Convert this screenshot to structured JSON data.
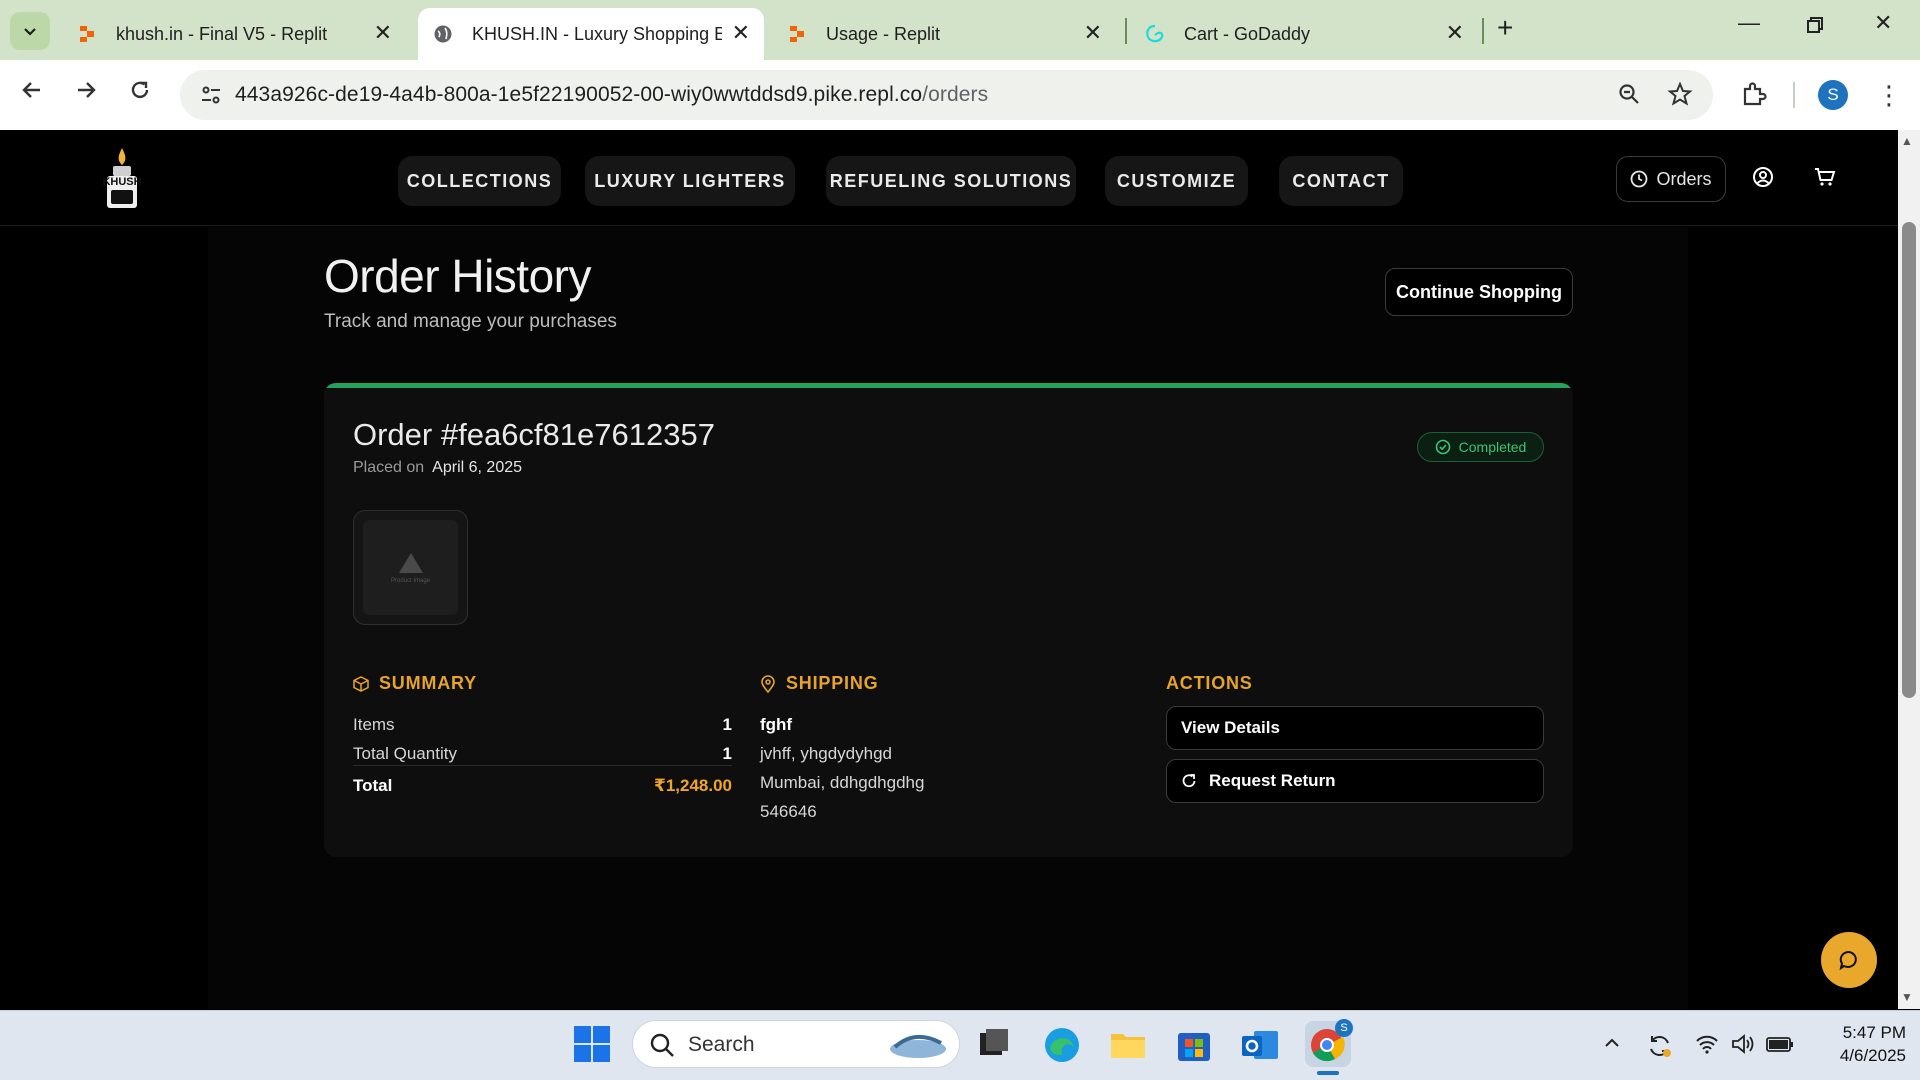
{
  "browser": {
    "tabs": [
      {
        "title": "khush.in - Final V5 - Replit",
        "icon": "replit-icon",
        "active": false
      },
      {
        "title": "KHUSH.IN - Luxury Shopping Ex",
        "icon": "globe-icon",
        "active": true
      },
      {
        "title": "Usage - Replit",
        "icon": "replit-icon",
        "active": false
      },
      {
        "title": "Cart - GoDaddy",
        "icon": "godaddy-icon",
        "active": false
      }
    ],
    "url_host": "443a926c-de19-4a4b-800a-1e5f22190052-00-wiy0wwtddsd9.pike.repl.co",
    "url_path": "/orders",
    "profile_initial": "S"
  },
  "site": {
    "logo_text": "KHUSH",
    "nav": [
      "COLLECTIONS",
      "LUXURY LIGHTERS",
      "REFUELING SOLUTIONS",
      "CUSTOMIZE",
      "CONTACT"
    ],
    "orders_label": "Orders"
  },
  "page": {
    "title": "Order History",
    "subtitle": "Track and manage your purchases",
    "continue_label": "Continue Shopping"
  },
  "order": {
    "id_label": "Order #fea6cf81e7612357",
    "placed_label": "Placed on",
    "placed_date": "April 6, 2025",
    "status": "Completed",
    "image_caption": "Product Image",
    "summary": {
      "heading": "SUMMARY",
      "items_label": "Items",
      "items_value": "1",
      "qty_label": "Total Quantity",
      "qty_value": "1",
      "total_label": "Total",
      "total_value": "₹1,248.00"
    },
    "shipping": {
      "heading": "SHIPPING",
      "name": "fghf",
      "line1": "jvhff, yhgdydyhgd",
      "line2": "Mumbai, ddhgdhgdhg",
      "line3": "546646"
    },
    "actions": {
      "heading": "ACTIONS",
      "view_details": "View Details",
      "request_return": "Request Return"
    }
  },
  "taskbar": {
    "search_label": "Search",
    "time": "5:47 PM",
    "date": "4/6/2025"
  },
  "colors": {
    "accent": "#e9a82b",
    "status_green": "#22a55a",
    "tab_bar": "#d3e3c9"
  }
}
